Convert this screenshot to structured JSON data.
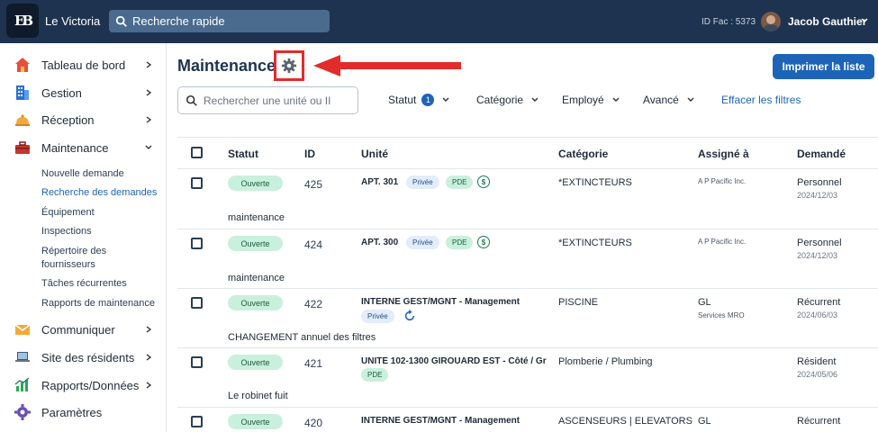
{
  "topbar": {
    "logo_text": "EB",
    "app_name": "Le Victoria",
    "search_placeholder": "Recherche rapide",
    "fac_id": "ID Fac : 5373",
    "user_name": "Jacob Gauthier"
  },
  "sidebar": {
    "items": [
      {
        "label": "Tableau de bord",
        "icon": "home-icon"
      },
      {
        "label": "Gestion",
        "icon": "building-icon"
      },
      {
        "label": "Réception",
        "icon": "bell-icon"
      },
      {
        "label": "Maintenance",
        "icon": "toolbox-icon"
      },
      {
        "label": "Communiquer",
        "icon": "mail-icon"
      },
      {
        "label": "Site des résidents",
        "icon": "laptop-icon"
      },
      {
        "label": "Rapports/Données",
        "icon": "chart-icon"
      },
      {
        "label": "Paramètres",
        "icon": "gear-icon"
      }
    ],
    "maintenance_sub": [
      "Nouvelle demande",
      "Recherche des demandes",
      "Équipement",
      "Inspections",
      "Répertoire des",
      "fournisseurs",
      "Tâches récurrentes",
      "Rapports de maintenance"
    ]
  },
  "main": {
    "title": "Maintenance",
    "print_label": "Imprimer la liste",
    "search_placeholder": "Rechercher une unité ou II",
    "filters": {
      "statut": "Statut",
      "statut_count": "1",
      "categorie": "Catégorie",
      "employe": "Employé",
      "avance": "Avancé",
      "clear": "Effacer les filtres"
    },
    "columns": {
      "statut": "Statut",
      "id": "ID",
      "unite": "Unité",
      "categorie": "Catégorie",
      "assigne": "Assigné à",
      "demande": "Demandé"
    },
    "rows": [
      {
        "status": "Ouverte",
        "id": "425",
        "unit": "APT. 301",
        "tag1": "Privée",
        "tag2": "PDE",
        "dollar": "$",
        "category": "*EXTINCTEURS",
        "assigned": "A P Pacific Inc.",
        "requested": "Personnel",
        "date": "2024/12/03",
        "desc": "maintenance"
      },
      {
        "status": "Ouverte",
        "id": "424",
        "unit": "APT. 300",
        "tag1": "Privée",
        "tag2": "PDE",
        "dollar": "$",
        "category": "*EXTINCTEURS",
        "assigned": "A P Pacific Inc.",
        "requested": "Personnel",
        "date": "2024/12/03",
        "desc": "maintenance"
      },
      {
        "status": "Ouverte",
        "id": "422",
        "unit": "INTERNE GEST/MGNT - Management",
        "tag1": "Privée",
        "category": "PISCINE",
        "assigned": "GL",
        "assigned2": "Services MRO",
        "requested": "Récurrent",
        "date": "2024/06/03",
        "desc": "CHANGEMENT annuel des filtres"
      },
      {
        "status": "Ouverte",
        "id": "421",
        "unit": "UNITÉ 102-1300 GIROUARD EST - Côté / Gr",
        "tag2": "PDE",
        "category": "Plomberie / Plumbing",
        "requested": "Résident",
        "date": "2024/05/06",
        "desc": "Le robinet fuit"
      },
      {
        "status": "Ouverte",
        "id": "420",
        "unit": "INTERNE GEST/MGNT - Management",
        "category": "ASCENSEURS | ELEVATORS",
        "assigned": "GL",
        "requested": "Récurrent"
      }
    ]
  },
  "colors": {
    "topbar": "#1e3350",
    "accent": "#1d64b9",
    "highlight": "#e32b2b",
    "open_badge": "#c9f0dd"
  }
}
